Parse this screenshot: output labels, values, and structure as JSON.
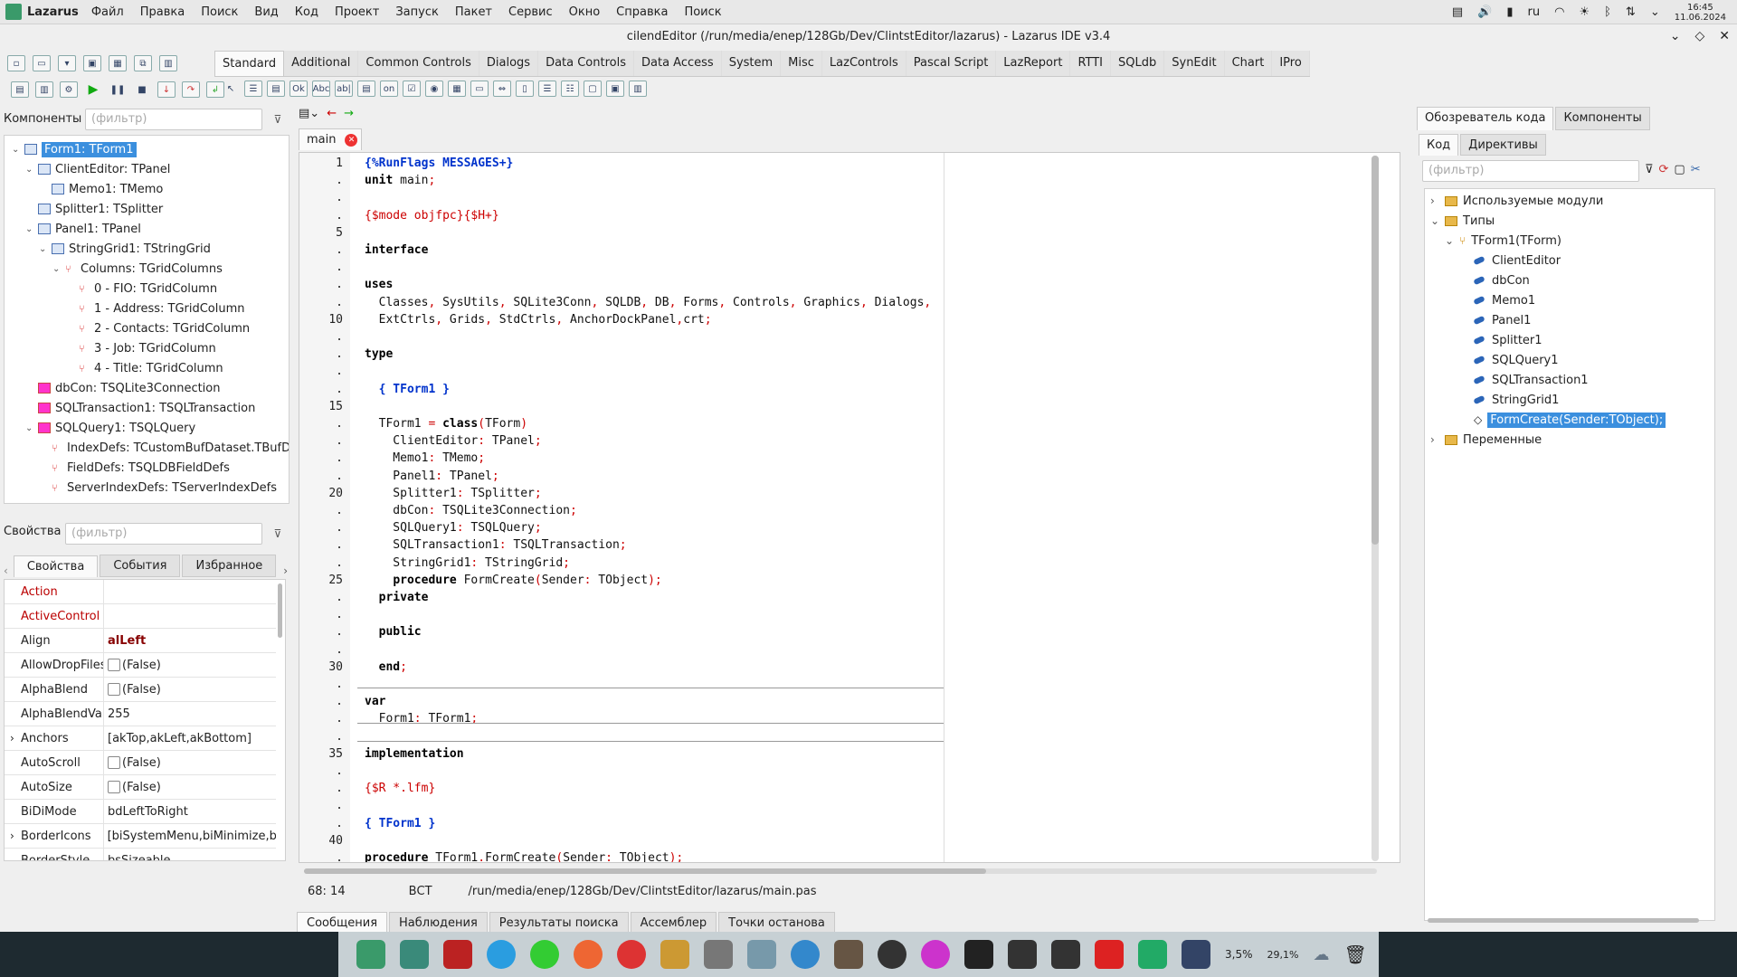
{
  "menubar": {
    "app_name": "Lazarus",
    "items": [
      "Файл",
      "Правка",
      "Поиск",
      "Вид",
      "Код",
      "Проект",
      "Запуск",
      "Пакет",
      "Сервис",
      "Окно",
      "Справка",
      "Поиск"
    ],
    "lang": "ru",
    "time": "16:45",
    "date": "11.06.2024"
  },
  "window": {
    "title": "cilendEditor (/run/media/enep/128Gb/Dev/ClintstEditor/lazarus) - Lazarus IDE v3.4"
  },
  "palette": {
    "tabs": [
      "Standard",
      "Additional",
      "Common Controls",
      "Dialogs",
      "Data Controls",
      "Data Access",
      "System",
      "Misc",
      "LazControls",
      "Pascal Script",
      "LazReport",
      "RTTI",
      "SQLdb",
      "SynEdit",
      "Chart",
      "IPro"
    ],
    "active": "Standard"
  },
  "components_panel": {
    "label": "Компоненты",
    "filter_placeholder": "(фильтр)",
    "tree": [
      {
        "text": "Form1: TForm1",
        "level": 0,
        "expanded": true,
        "selected": true,
        "icon": "form-icon"
      },
      {
        "text": "ClientEditor: TPanel",
        "level": 1,
        "expanded": true,
        "icon": "panel-icon"
      },
      {
        "text": "Memo1: TMemo",
        "level": 2,
        "icon": "memo-icon"
      },
      {
        "text": "Splitter1: TSplitter",
        "level": 1,
        "icon": "splitter-icon"
      },
      {
        "text": "Panel1: TPanel",
        "level": 1,
        "expanded": true,
        "icon": "panel-icon"
      },
      {
        "text": "StringGrid1: TStringGrid",
        "level": 2,
        "expanded": true,
        "icon": "grid-icon"
      },
      {
        "text": "Columns: TGridColumns",
        "level": 3,
        "expanded": true,
        "icon": "collection-icon"
      },
      {
        "text": "0 - FIO: TGridColumn",
        "level": 4,
        "icon": "column-icon"
      },
      {
        "text": "1 - Address: TGridColumn",
        "level": 4,
        "icon": "column-icon"
      },
      {
        "text": "2 - Contacts: TGridColumn",
        "level": 4,
        "icon": "column-icon"
      },
      {
        "text": "3 - Job: TGridColumn",
        "level": 4,
        "icon": "column-icon"
      },
      {
        "text": "4 - Title: TGridColumn",
        "level": 4,
        "icon": "column-icon"
      },
      {
        "text": "dbCon: TSQLite3Connection",
        "level": 1,
        "icon": "database-icon"
      },
      {
        "text": "SQLTransaction1: TSQLTransaction",
        "level": 1,
        "icon": "database-icon"
      },
      {
        "text": "SQLQuery1: TSQLQuery",
        "level": 1,
        "expanded": true,
        "icon": "database-icon"
      },
      {
        "text": "IndexDefs: TCustomBufDataset.TBufDat",
        "level": 2,
        "icon": "collection-icon"
      },
      {
        "text": "FieldDefs: TSQLDBFieldDefs",
        "level": 2,
        "icon": "collection-icon"
      },
      {
        "text": "ServerIndexDefs: TServerIndexDefs",
        "level": 2,
        "icon": "collection-icon"
      }
    ]
  },
  "properties_panel": {
    "label": "Свойства",
    "filter_placeholder": "(фильтр)",
    "tabs": [
      "Свойства",
      "События",
      "Избранное"
    ],
    "rows": [
      {
        "name": "Action",
        "value": "",
        "red": true
      },
      {
        "name": "ActiveControl",
        "value": "",
        "red": true
      },
      {
        "name": "Align",
        "value": "alLeft",
        "bold": true
      },
      {
        "name": "AllowDropFiles",
        "value": "(False)",
        "checkbox": true
      },
      {
        "name": "AlphaBlend",
        "value": "(False)",
        "checkbox": true
      },
      {
        "name": "AlphaBlendValue",
        "value": "255"
      },
      {
        "name": "Anchors",
        "value": "[akTop,akLeft,akBottom]",
        "expandable": true
      },
      {
        "name": "AutoScroll",
        "value": "(False)",
        "checkbox": true
      },
      {
        "name": "AutoSize",
        "value": "(False)",
        "checkbox": true
      },
      {
        "name": "BiDiMode",
        "value": "bdLeftToRight"
      },
      {
        "name": "BorderIcons",
        "value": "[biSystemMenu,biMinimize,b",
        "expandable": true
      },
      {
        "name": "BorderStyle",
        "value": "bsSizeable"
      }
    ]
  },
  "editor": {
    "tab": "main",
    "lines": [
      {
        "n": "1",
        "html": "<span class='cm'>{%RunFlags MESSAGES+}</span>"
      },
      {
        "n": ".",
        "html": "<span class='kw'>unit</span> main<span class='sym'>;</span>"
      },
      {
        "n": ".",
        "html": ""
      },
      {
        "n": ".",
        "html": "<span class='dir'>{$mode objfpc}{$H+}</span>"
      },
      {
        "n": "5",
        "html": ""
      },
      {
        "n": ".",
        "html": "<span class='kw'>interface</span>"
      },
      {
        "n": ".",
        "html": ""
      },
      {
        "n": ".",
        "html": "<span class='kw'>uses</span>"
      },
      {
        "n": ".",
        "html": "  Classes<span class='sym'>,</span> SysUtils<span class='sym'>,</span> SQLite3Conn<span class='sym'>,</span> SQLDB<span class='sym'>,</span> DB<span class='sym'>,</span> Forms<span class='sym'>,</span> Controls<span class='sym'>,</span> Graphics<span class='sym'>,</span> Dialogs<span class='sym'>,</span>"
      },
      {
        "n": "10",
        "html": "  ExtCtrls<span class='sym'>,</span> Grids<span class='sym'>,</span> StdCtrls<span class='sym'>,</span> AnchorDockPanel<span class='sym'>,</span>crt<span class='sym'>;</span>"
      },
      {
        "n": ".",
        "html": ""
      },
      {
        "n": ".",
        "html": "<span class='kw'>type</span>"
      },
      {
        "n": ".",
        "html": ""
      },
      {
        "n": ".",
        "html": "  <span class='cm'>{ TForm1 }</span>"
      },
      {
        "n": "15",
        "html": ""
      },
      {
        "n": ".",
        "html": "  TForm1 <span class='sym'>=</span> <span class='kw'>class</span><span class='sym'>(</span>TForm<span class='sym'>)</span>"
      },
      {
        "n": ".",
        "html": "    ClientEditor<span class='sym'>:</span> TPanel<span class='sym'>;</span>"
      },
      {
        "n": ".",
        "html": "    Memo1<span class='sym'>:</span> TMemo<span class='sym'>;</span>"
      },
      {
        "n": ".",
        "html": "    Panel1<span class='sym'>:</span> TPanel<span class='sym'>;</span>"
      },
      {
        "n": "20",
        "html": "    Splitter1<span class='sym'>:</span> TSplitter<span class='sym'>;</span>"
      },
      {
        "n": ".",
        "html": "    dbCon<span class='sym'>:</span> TSQLite3Connection<span class='sym'>;</span>"
      },
      {
        "n": ".",
        "html": "    SQLQuery1<span class='sym'>:</span> TSQLQuery<span class='sym'>;</span>"
      },
      {
        "n": ".",
        "html": "    SQLTransaction1<span class='sym'>:</span> TSQLTransaction<span class='sym'>;</span>"
      },
      {
        "n": ".",
        "html": "    StringGrid1<span class='sym'>:</span> TStringGrid<span class='sym'>;</span>"
      },
      {
        "n": "25",
        "html": "    <span class='kw'>procedure</span> FormCreate<span class='sym'>(</span>Sender<span class='sym'>:</span> TObject<span class='sym'>);</span>"
      },
      {
        "n": ".",
        "html": "  <span class='kw'>private</span>"
      },
      {
        "n": ".",
        "html": ""
      },
      {
        "n": ".",
        "html": "  <span class='kw'>public</span>"
      },
      {
        "n": ".",
        "html": ""
      },
      {
        "n": "30",
        "html": "  <span class='kw'>end</span><span class='sym'>;</span>"
      },
      {
        "n": ".",
        "html": ""
      },
      {
        "n": ".",
        "html": "<span class='kw'>var</span>"
      },
      {
        "n": ".",
        "html": "  Form1<span class='sym'>:</span> TForm1<span class='sym'>;</span>"
      },
      {
        "n": ".",
        "html": ""
      },
      {
        "n": "35",
        "html": "<span class='kw'>implementation</span>"
      },
      {
        "n": ".",
        "html": ""
      },
      {
        "n": ".",
        "html": "<span class='dir'>{$R *.lfm}</span>"
      },
      {
        "n": ".",
        "html": ""
      },
      {
        "n": ".",
        "html": "<span class='cm'>{ TForm1 }</span>"
      },
      {
        "n": "40",
        "html": ""
      },
      {
        "n": ".",
        "html": "<span class='kw'>procedure</span> TForm1<span class='sym'>.</span>FormCreate<span class='sym'>(</span>Sender<span class='sym'>:</span> TObject<span class='sym'>);</span>"
      }
    ],
    "status_pos": "68: 14",
    "status_mode": "ВСТ",
    "status_path": "/run/media/enep/128Gb/Dev/ClintstEditor/lazarus/main.pas"
  },
  "message_tabs": [
    "Сообщения",
    "Наблюдения",
    "Результаты поиска",
    "Ассемблер",
    "Точки останова"
  ],
  "code_explorer": {
    "tabs": [
      "Обозреватель кода",
      "Компоненты"
    ],
    "subtabs": [
      "Код",
      "Директивы"
    ],
    "filter_placeholder": "(фильтр)",
    "tree": [
      {
        "text": "Используемые модули",
        "level": 0,
        "type": "folder",
        "expander": "›"
      },
      {
        "text": "Типы",
        "level": 0,
        "type": "folder",
        "expander": "⌄"
      },
      {
        "text": "TForm1(TForm)",
        "level": 1,
        "type": "class",
        "expander": "⌄"
      },
      {
        "text": "ClientEditor",
        "level": 2,
        "type": "field"
      },
      {
        "text": "dbCon",
        "level": 2,
        "type": "field"
      },
      {
        "text": "Memo1",
        "level": 2,
        "type": "field"
      },
      {
        "text": "Panel1",
        "level": 2,
        "type": "field"
      },
      {
        "text": "Splitter1",
        "level": 2,
        "type": "field"
      },
      {
        "text": "SQLQuery1",
        "level": 2,
        "type": "field"
      },
      {
        "text": "SQLTransaction1",
        "level": 2,
        "type": "field"
      },
      {
        "text": "StringGrid1",
        "level": 2,
        "type": "field"
      },
      {
        "text": "FormCreate(Sender:TObject);",
        "level": 2,
        "type": "method",
        "selected": true
      },
      {
        "text": "Переменные",
        "level": 0,
        "type": "folder",
        "expander": "›"
      }
    ]
  },
  "tray": {
    "cpu": "3,5%",
    "mem": "29,1%"
  }
}
